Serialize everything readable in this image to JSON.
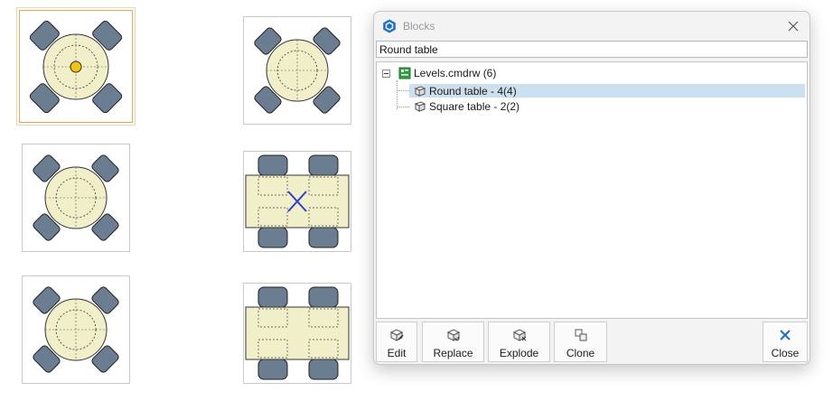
{
  "dialog": {
    "title": "Blocks",
    "search_value": "Round table",
    "tree": {
      "root": {
        "label": "Levels.cmdrw (6)",
        "expanded": true
      },
      "children": [
        {
          "label": "Round table - 4(4)",
          "selected": true
        },
        {
          "label": "Square table - 2(2)",
          "selected": false
        }
      ]
    },
    "toolbar": {
      "edit": "Edit",
      "replace": "Replace",
      "explode": "Explode",
      "clone": "Clone",
      "close": "Close"
    }
  },
  "colors": {
    "accent": "#1f6fd1",
    "selection": "#cde0ef",
    "table_fill": "#f1efc9",
    "chair_fill": "#687b8f",
    "selected_tile_border": "#e0a85a",
    "grip": "#f1c40f"
  }
}
